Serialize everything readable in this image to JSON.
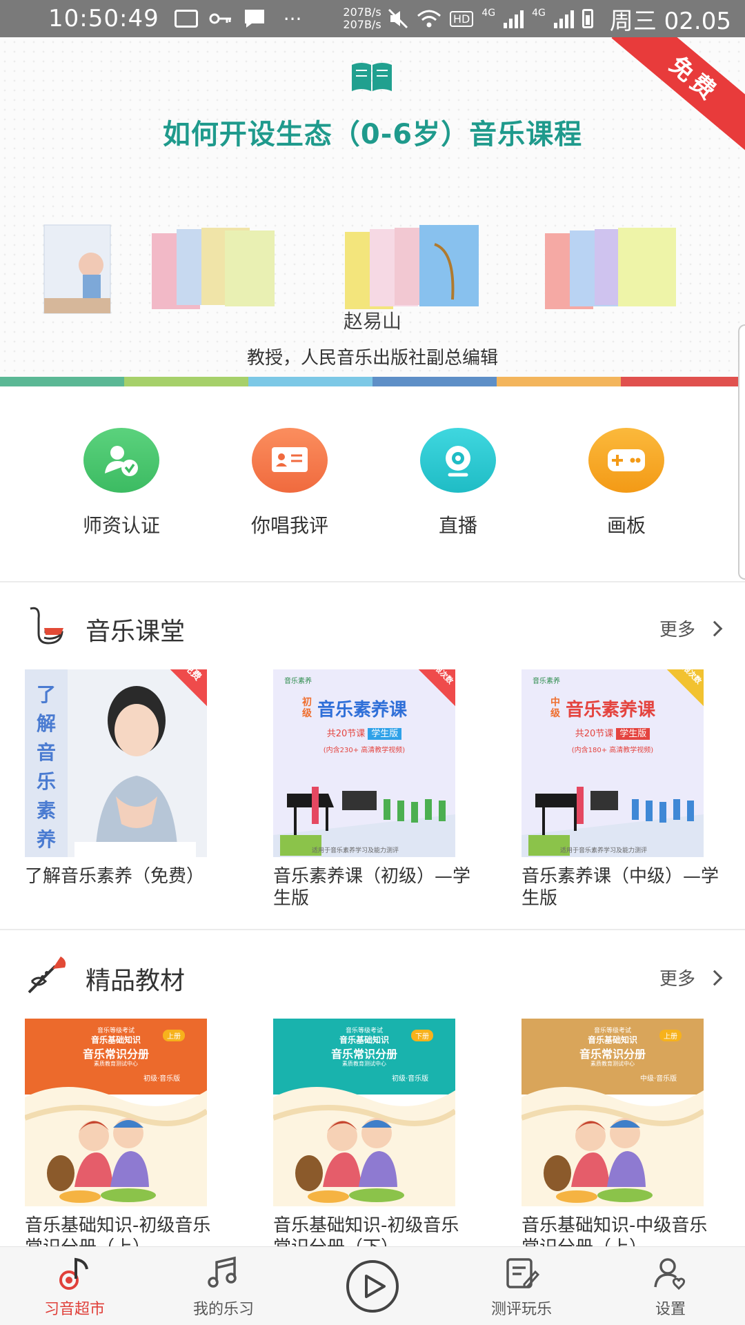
{
  "status_bar": {
    "time": "10:50:49",
    "speed_up": "207B/s",
    "speed_down": "207B/s",
    "network": "4G",
    "hd": "HD",
    "date": "周三 02.05"
  },
  "banner": {
    "title": "如何开设生态（0-6岁）音乐课程",
    "ribbon": "免费",
    "author": "赵易山",
    "role": "教授，人民音乐出版社副总编辑",
    "dots_count": 6,
    "active_dot": 0,
    "stripe_colors": [
      "#5bb895",
      "#a6d06a",
      "#7cc8e6",
      "#5e8fc7",
      "#f3b55c",
      "#e0514e"
    ],
    "colors": {
      "title": "#1f9a8c",
      "ribbon": "#e83b3b"
    }
  },
  "quick_actions": [
    {
      "label": "师资认证",
      "icon": "teacher-cert-icon",
      "color": "#43c46b"
    },
    {
      "label": "你唱我评",
      "icon": "sing-review-icon",
      "color": "#f4774a"
    },
    {
      "label": "直播",
      "icon": "live-camera-icon",
      "color": "#2ec7cf"
    },
    {
      "label": "画板",
      "icon": "gamepad-icon",
      "color": "#f6a623"
    }
  ],
  "music_class": {
    "title": "音乐课堂",
    "more": "更多",
    "items": [
      {
        "name": "了解音乐素养（免费）",
        "vertical_text": "了解音乐素养",
        "corner": "免费",
        "corner_color": "#ef4b4b"
      },
      {
        "name": "音乐素养课（初级）—学生版",
        "level": "初级",
        "heading": "音乐素养课",
        "sub": "共20节课",
        "sub_tag": "学生版",
        "note": "(内含230+ 高清教学视频)",
        "corner": "不限次数",
        "corner_color": "#ef4b4b",
        "heading_color": "#2f6fd8",
        "logo": "音乐素养",
        "foot": "适用于音乐素养学习及能力测评"
      },
      {
        "name": "音乐素养课（中级）—学生版",
        "level": "中级",
        "heading": "音乐素养课",
        "sub": "共20节课",
        "sub_tag": "学生版",
        "note": "(内含180+ 高清教学视频)",
        "corner": "不限次数",
        "corner_color": "#f2c230",
        "heading_color": "#e4443f",
        "logo": "音乐素养",
        "foot": "适用于音乐素养学习及能力测评"
      }
    ]
  },
  "textbooks": {
    "title": "精品教材",
    "more": "更多",
    "items": [
      {
        "name": "音乐基础知识-初级音乐常识分册（上）",
        "t1": "音乐等级考试",
        "t2": "音乐基础知识",
        "t3": "音乐常识分册",
        "t4": "素质教育测试中心",
        "tag": "上册",
        "lv": "初级·音乐版",
        "color": "#ec6a2c"
      },
      {
        "name": "音乐基础知识-初级音乐常识分册（下）",
        "t1": "音乐等级考试",
        "t2": "音乐基础知识",
        "t3": "音乐常识分册",
        "t4": "素质教育测试中心",
        "tag": "下册",
        "lv": "初级·音乐版",
        "color": "#19b3ad"
      },
      {
        "name": "音乐基础知识-中级音乐常识分册（上）",
        "t1": "音乐等级考试",
        "t2": "音乐基础知识",
        "t3": "音乐常识分册",
        "t4": "素质教育测试中心",
        "tag": "上册",
        "lv": "中级·音乐版",
        "color": "#d9a55a"
      }
    ]
  },
  "bottom_nav": {
    "tabs": [
      {
        "label": "习音超市",
        "icon": "music-note-icon",
        "active": true
      },
      {
        "label": "我的乐习",
        "icon": "notes-icon",
        "active": false
      },
      {
        "label": "",
        "icon": "play-icon",
        "active": false
      },
      {
        "label": "测评玩乐",
        "icon": "assessment-icon",
        "active": false
      },
      {
        "label": "设置",
        "icon": "settings-person-icon",
        "active": false
      }
    ],
    "active_color": "#e0403a"
  }
}
